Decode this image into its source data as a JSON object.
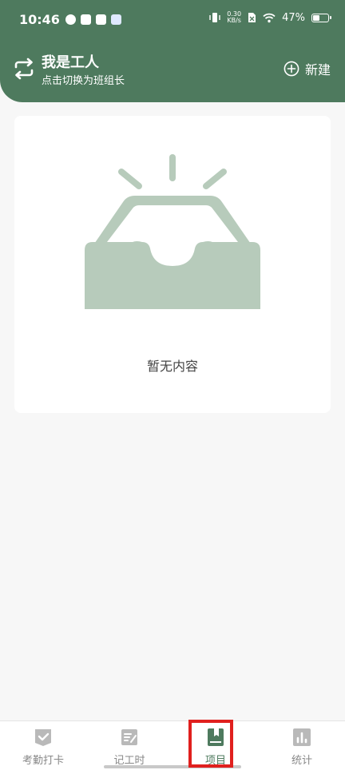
{
  "status_bar": {
    "time": "10:46",
    "net_speed_value": "0.30",
    "net_speed_unit": "KB/s",
    "battery": "47%",
    "battery_level": 0.47
  },
  "header": {
    "role_title": "我是工人",
    "role_subtitle": "点击切换为班组长",
    "new_label": "新建",
    "switch_icon": "swap-arrows-icon",
    "new_icon": "plus-circle-icon"
  },
  "empty_state": {
    "message": "暂无内容",
    "icon": "empty-inbox-icon"
  },
  "tabs": [
    {
      "label": "考勤打卡",
      "icon": "checkin-check-icon",
      "active": false
    },
    {
      "label": "记工时",
      "icon": "worklog-edit-icon",
      "active": false
    },
    {
      "label": "项目",
      "icon": "project-book-icon",
      "active": true
    },
    {
      "label": "统计",
      "icon": "stats-bar-icon",
      "active": false
    }
  ],
  "colors": {
    "brand": "#4e7a5e",
    "empty_icon": "#b7cbbb",
    "tab_inactive": "#b9b9b9",
    "highlight": "#e0201e"
  }
}
